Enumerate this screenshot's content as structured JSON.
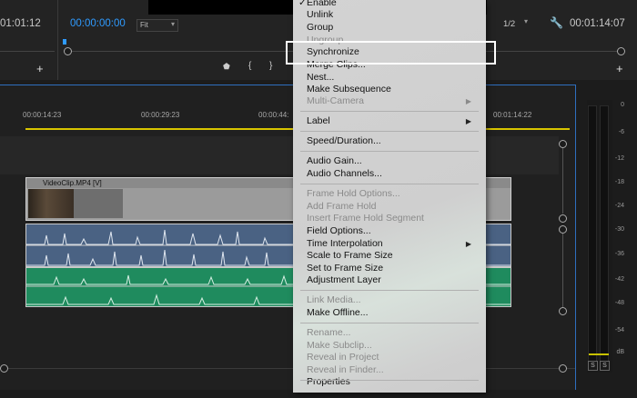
{
  "monitor": {
    "left_timecode": "01:01:12",
    "source_timecode": "00:00:00:00",
    "fit_label": "Fit",
    "resolution_label": "1/2",
    "right_timecode": "00:01:14:07"
  },
  "timeline": {
    "ruler_labels": [
      "00:00:14:23",
      "00:00:29:23",
      "00:00:44:",
      "00:01:14:22"
    ],
    "video_clip_name": "VideoClip.MP4 [V]"
  },
  "meter": {
    "scale": [
      "0",
      "-6",
      "-12",
      "-18",
      "-24",
      "-30",
      "-36",
      "-42",
      "-48",
      "-54",
      "dB"
    ],
    "solo_labels": [
      "S",
      "S"
    ]
  },
  "context_menu": {
    "items": [
      {
        "label": "Enable",
        "check": "✓",
        "enabled": true
      },
      {
        "label": "Unlink",
        "enabled": true
      },
      {
        "label": "Group",
        "enabled": true
      },
      {
        "label": "Ungroup",
        "enabled": false
      },
      {
        "label": "Synchronize",
        "enabled": true
      },
      {
        "label": "Merge Clips...",
        "enabled": true
      },
      {
        "label": "Nest...",
        "enabled": true
      },
      {
        "label": "Make Subsequence",
        "enabled": true
      },
      {
        "label": "Multi-Camera",
        "enabled": false,
        "submenu": true
      },
      {
        "label": "Label",
        "enabled": true,
        "submenu": true
      },
      {
        "label": "Speed/Duration...",
        "enabled": true
      },
      {
        "label": "Audio Gain...",
        "enabled": true
      },
      {
        "label": "Audio Channels...",
        "enabled": true
      },
      {
        "label": "Frame Hold Options...",
        "enabled": false
      },
      {
        "label": "Add Frame Hold",
        "enabled": false
      },
      {
        "label": "Insert Frame Hold Segment",
        "enabled": false
      },
      {
        "label": "Field Options...",
        "enabled": true
      },
      {
        "label": "Time Interpolation",
        "enabled": true,
        "submenu": true
      },
      {
        "label": "Scale to Frame Size",
        "enabled": true
      },
      {
        "label": "Set to Frame Size",
        "enabled": true
      },
      {
        "label": "Adjustment Layer",
        "enabled": true
      },
      {
        "label": "Link Media...",
        "enabled": false
      },
      {
        "label": "Make Offline...",
        "enabled": true
      },
      {
        "label": "Rename...",
        "enabled": false
      },
      {
        "label": "Make Subclip...",
        "enabled": false
      },
      {
        "label": "Reveal in Project",
        "enabled": false
      },
      {
        "label": "Reveal in Finder...",
        "enabled": false
      },
      {
        "label": "Properties",
        "enabled": true
      }
    ],
    "highlighted": "Synchronize"
  },
  "colors": {
    "accent_blue": "#2f9bff",
    "audio_track_1": "#4a6283",
    "audio_track_2": "#1f8b5e",
    "work_area_yellow": "#d9c500"
  }
}
